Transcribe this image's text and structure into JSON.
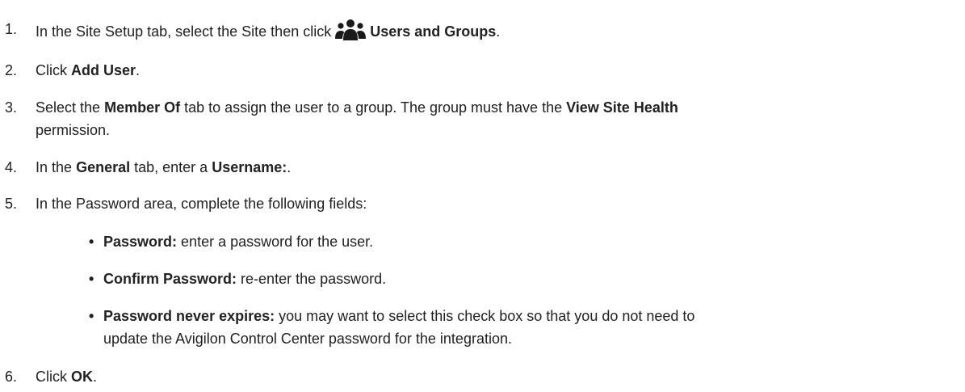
{
  "steps": [
    {
      "num": "1.",
      "pre": "In the Site Setup tab, select the Site then click",
      "icon": "users-group-icon",
      "bold": "Users and Groups",
      "post": "."
    },
    {
      "num": "2.",
      "pre": "Click",
      "bold": "Add User",
      "post": "."
    },
    {
      "num": "3.",
      "pre": "Select the",
      "bold1": "Member Of",
      "mid": "tab to assign the user to a group. The group must have the",
      "bold2": "View Site Health",
      "post": "permission."
    },
    {
      "num": "4.",
      "pre": "In the",
      "bold1": "General",
      "mid": "tab, enter a",
      "bold2": "Username:",
      "post": "."
    },
    {
      "num": "5.",
      "text": "In the Password area, complete the following fields:",
      "bullets": [
        {
          "bold": "Password:",
          "text": "enter a password for the user."
        },
        {
          "bold": "Confirm Password:",
          "text": "re-enter the password."
        },
        {
          "bold": "Password never expires:",
          "text": "you may want to select this check box so that you do not need to",
          "text2": "update the Avigilon Control Center password for the integration."
        }
      ]
    },
    {
      "num": "6.",
      "pre": "Click",
      "bold": "OK",
      "post": "."
    }
  ],
  "bullet_char": "•"
}
